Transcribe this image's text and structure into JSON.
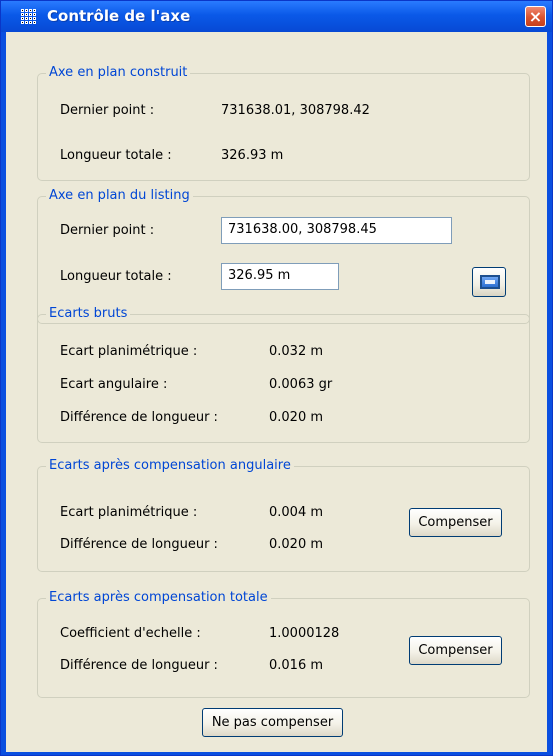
{
  "window": {
    "title": "Contrôle de l'axe",
    "close_label": "×"
  },
  "built_axis": {
    "title": "Axe en plan construit",
    "last_point_label": "Dernier point :",
    "last_point_value": "731638.01, 308798.42",
    "total_length_label": "Longueur totale :",
    "total_length_value": "326.93 m"
  },
  "listing_axis": {
    "title": "Axe en plan du listing",
    "last_point_label": "Dernier point :",
    "last_point_value": "731638.00, 308798.45",
    "total_length_label": "Longueur totale :",
    "total_length_value": "326.95 m"
  },
  "raw_deviations": {
    "title": "Ecarts bruts",
    "planimetric_label": "Ecart planimétrique :",
    "planimetric_value": "0.032 m",
    "angular_label": "Ecart angulaire :",
    "angular_value": "0.0063 gr",
    "length_diff_label": "Différence de longueur :",
    "length_diff_value": "0.020 m"
  },
  "angular_compensation": {
    "title": "Ecarts après compensation angulaire",
    "planimetric_label": "Ecart planimétrique :",
    "planimetric_value": "0.004 m",
    "length_diff_label": "Différence de longueur :",
    "length_diff_value": "0.020 m",
    "button_label": "Compenser"
  },
  "total_compensation": {
    "title": "Ecarts après compensation totale",
    "scale_factor_label": "Coefficient d'echelle :",
    "scale_factor_value": "1.0000128",
    "length_diff_label": "Différence de longueur :",
    "length_diff_value": "0.016 m",
    "button_label": "Compenser"
  },
  "footer": {
    "no_compensation_label": "Ne pas compenser"
  },
  "icons": {
    "window_icon": "grid-icon",
    "calculator_icon": "calculator-icon"
  },
  "colors": {
    "title_bar": "#0a59e8",
    "group_title": "#0046d5",
    "dialog_background": "#ece9d8",
    "close_button": "#d9532f"
  }
}
